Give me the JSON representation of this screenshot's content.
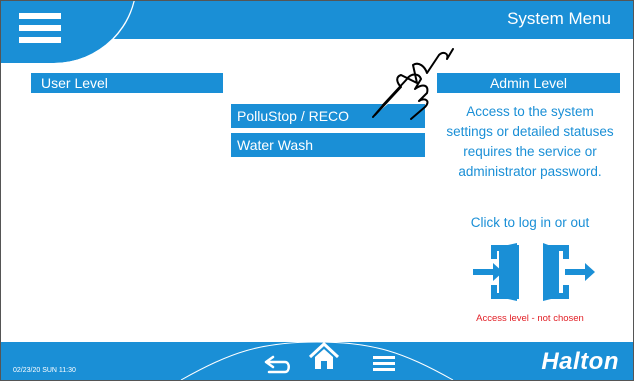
{
  "header": {
    "title": "System Menu"
  },
  "user_level": {
    "label": "User Level"
  },
  "admin_level": {
    "label": "Admin Level",
    "description": "Access to the system settings or detailed statuses requires the service or administrator password.",
    "login_hint": "Click to log in or out",
    "access_status": "Access level - not chosen"
  },
  "menu": {
    "pollustop_label": "PolluStop / RECO",
    "waterwash_label": "Water Wash"
  },
  "footer": {
    "datetime": "02/23/20 SUN 11:30",
    "brand": "Halton"
  },
  "colors": {
    "accent": "#1a8fd6",
    "warning": "#e21f26",
    "background": "#ffffff"
  },
  "icons": [
    "hamburger-menu-icon",
    "pointing-hand-icon",
    "login-door-icon",
    "logout-door-icon",
    "back-arrow-icon",
    "home-icon",
    "list-menu-icon"
  ]
}
